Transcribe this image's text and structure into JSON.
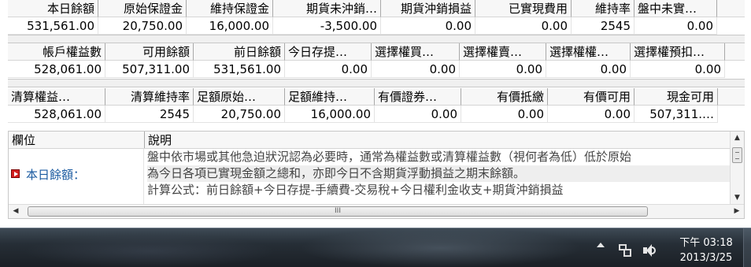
{
  "row1": {
    "headers": [
      "本日餘額",
      "原始保證金",
      "維持保證金",
      "期貨未沖銷…",
      "期貨沖銷損益",
      "已實現費用",
      "維持率",
      "盤中未實…"
    ],
    "values": [
      "531,561.00",
      "20,750.00",
      "16,000.00",
      "-3,500.00",
      "0.00",
      "0.00",
      "2545",
      "0.00"
    ]
  },
  "row2": {
    "headers": [
      "帳戶權益數",
      "可用餘額",
      "前日餘額",
      "今日存提…",
      "選擇權買…",
      "選擇權賣…",
      "選擇權權…",
      "選擇權預扣…"
    ],
    "values": [
      "528,061.00",
      "507,311.00",
      "531,561.00",
      "0.00",
      "0.00",
      "0.00",
      "0.00",
      "0.00"
    ]
  },
  "row3": {
    "headers": [
      "清算權益…",
      "清算維持率",
      "足額原始…",
      "足額維持…",
      "有價證券…",
      "有價抵繳",
      "有價可用",
      "現金可用"
    ],
    "values": [
      "528,061.00",
      "2545",
      "20,750.00",
      "16,000.00",
      "0.00",
      "0.00",
      "0.00",
      "507,311.…"
    ]
  },
  "desc": {
    "col_field": "欄位",
    "col_desc": "說明",
    "field_name": "本日餘額：",
    "lines": [
      "盤中依市場或其他急迫狀況認為必要時，通常為權益數或清算權益數（視何者為低）低於原始",
      "為今日各項已實現金額之總和，亦即今日不含期貨浮動損益之期末餘額。",
      "計算公式：前日餘額+今日存提-手續費-交易稅+今日權利金收支+期貨沖銷損益"
    ],
    "hscroll_grip": "III"
  },
  "taskbar": {
    "time": "下午 03:18",
    "date": "2013/3/25"
  },
  "icons": [
    "red-arrow-marker-icon",
    "scroll-up-icon",
    "scroll-down-icon",
    "scroll-left-icon",
    "scroll-right-icon",
    "tray-expand-icon",
    "network-icon",
    "volume-icon"
  ]
}
